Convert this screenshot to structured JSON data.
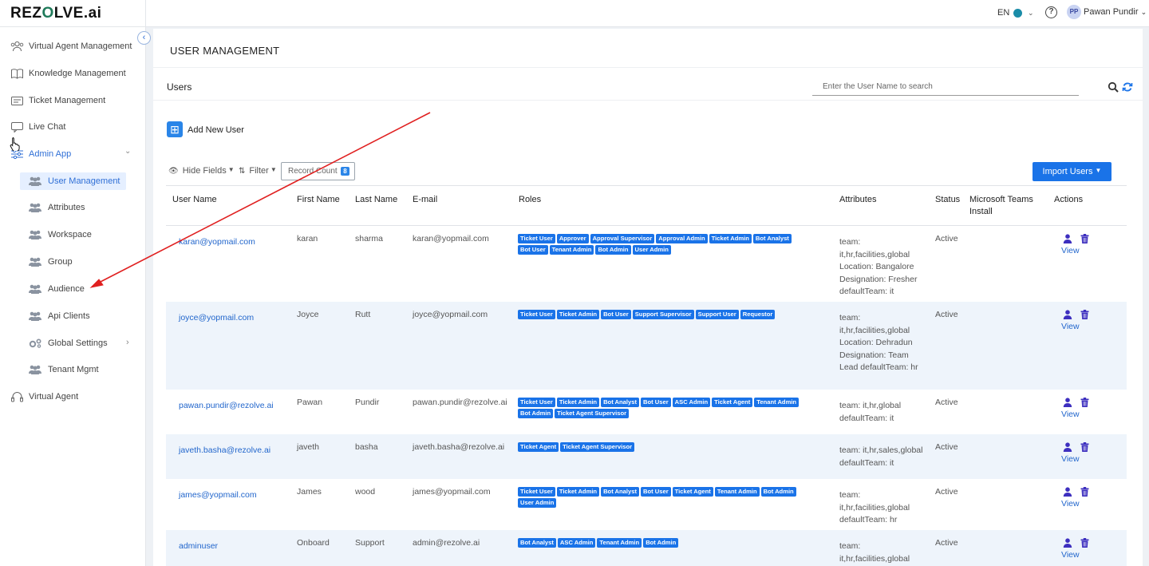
{
  "topbar": {
    "logo": "REZOLVE.ai",
    "language": "EN",
    "user_initials": "PP",
    "user_name": "Pawan Pundir"
  },
  "sidebar": {
    "items": [
      {
        "label": "Virtual Agent Management",
        "icon": "users-icon"
      },
      {
        "label": "Knowledge Management",
        "icon": "book-icon"
      },
      {
        "label": "Ticket Management",
        "icon": "ticket-icon"
      },
      {
        "label": "Live Chat",
        "icon": "chat-icon"
      },
      {
        "label": "Admin App",
        "icon": "sliders-icon"
      },
      {
        "label": "Virtual Agent",
        "icon": "headset-icon"
      }
    ],
    "admin_sub_items": [
      {
        "label": "User Management",
        "active": true
      },
      {
        "label": "Attributes"
      },
      {
        "label": "Workspace"
      },
      {
        "label": "Group"
      },
      {
        "label": "Audience"
      },
      {
        "label": "Api Clients"
      },
      {
        "label": "Global Settings"
      },
      {
        "label": "Tenant Mgmt"
      }
    ]
  },
  "page": {
    "title": "USER MANAGEMENT",
    "section_label": "Users",
    "search_placeholder": "Enter the User Name to search",
    "add_label": "Add New User",
    "hide_fields": "Hide Fields",
    "filter": "Filter",
    "record_count_label": "Record Count",
    "record_count": "8",
    "import_label": "Import Users"
  },
  "table": {
    "headers": [
      "User Name",
      "First Name",
      "Last Name",
      "E-mail",
      "Roles",
      "Attributes",
      "Status",
      "Microsoft Teams Install",
      "Actions"
    ],
    "view_label": "View",
    "rows": [
      {
        "username": "karan@yopmail.com",
        "first": "karan",
        "last": "sharma",
        "email": "karan@yopmail.com",
        "roles": [
          "Ticket User",
          "Approver",
          "Approval Supervisor",
          "Approval Admin",
          "Ticket Admin",
          "Bot Analyst",
          "Bot User",
          "Tenant Admin",
          "Bot Admin",
          "User Admin"
        ],
        "attributes": "team: it,hr,facilities,global Location: Bangalore Designation: Fresher defaultTeam: it",
        "status": "Active"
      },
      {
        "username": "joyce@yopmail.com",
        "first": "Joyce",
        "last": "Rutt",
        "email": "joyce@yopmail.com",
        "roles": [
          "Ticket User",
          "Ticket Admin",
          "Bot User",
          "Support Supervisor",
          "Support User",
          "Requestor"
        ],
        "attributes": "team: it,hr,facilities,global Location: Dehradun Designation: Team Lead defaultTeam: hr",
        "status": "Active"
      },
      {
        "username": "pawan.pundir@rezolve.ai",
        "first": "Pawan",
        "last": "Pundir",
        "email": "pawan.pundir@rezolve.ai",
        "roles": [
          "Ticket User",
          "Ticket Admin",
          "Bot Analyst",
          "Bot User",
          "ASC Admin",
          "Ticket Agent",
          "Tenant Admin",
          "Bot Admin",
          "Ticket Agent Supervisor"
        ],
        "attributes": "team: it,hr,global defaultTeam: it",
        "status": "Active"
      },
      {
        "username": "javeth.basha@rezolve.ai",
        "first": "javeth",
        "last": "basha",
        "email": "javeth.basha@rezolve.ai",
        "roles": [
          "Ticket Agent",
          "Ticket Agent Supervisor"
        ],
        "attributes": "team: it,hr,sales,global defaultTeam: it",
        "status": "Active"
      },
      {
        "username": "james@yopmail.com",
        "first": "James",
        "last": "wood",
        "email": "james@yopmail.com",
        "roles": [
          "Ticket User",
          "Ticket Admin",
          "Bot Analyst",
          "Bot User",
          "Ticket Agent",
          "Tenant Admin",
          "Bot Admin",
          "User Admin"
        ],
        "attributes": "team: it,hr,facilities,global defaultTeam: hr",
        "status": "Active"
      },
      {
        "username": "adminuser",
        "first": "Onboard",
        "last": "Support",
        "email": "admin@rezolve.ai",
        "roles": [
          "Bot Analyst",
          "ASC Admin",
          "Tenant Admin",
          "Bot Admin"
        ],
        "attributes": "team: it,hr,facilities,global defaultTeam: it",
        "status": "Active"
      }
    ]
  },
  "colors": {
    "accent": "#1a73e8",
    "link": "#2266cc",
    "annotation_arrow": "#e02020"
  }
}
